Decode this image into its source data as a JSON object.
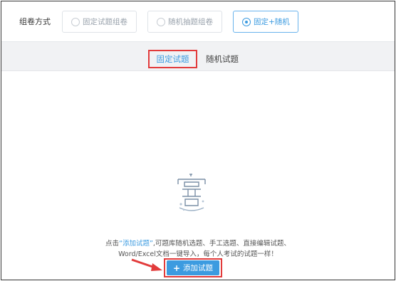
{
  "mode": {
    "label": "组卷方式",
    "options": [
      {
        "label": "固定试题组卷",
        "selected": false
      },
      {
        "label": "随机抽题组卷",
        "selected": false
      },
      {
        "label": "固定+随机",
        "selected": true
      }
    ]
  },
  "tabs": [
    {
      "label": "固定试题",
      "active": true
    },
    {
      "label": "随机试题",
      "active": false
    }
  ],
  "empty": {
    "icon": "empty-box-icon",
    "hint_prefix": "点击",
    "hint_link": "“添加试题”",
    "hint_line1_rest": ",可题库随机选题、手工选题、直接编辑试题、",
    "hint_line2": "Word/Excel文档一键导入，每个人考试的试题一样！"
  },
  "add_button": {
    "label": "添加试题",
    "icon": "plus-icon"
  },
  "colors": {
    "accent": "#3c9be0",
    "highlight": "#e23b3b",
    "tabbar_bg": "#f1f2f4"
  }
}
